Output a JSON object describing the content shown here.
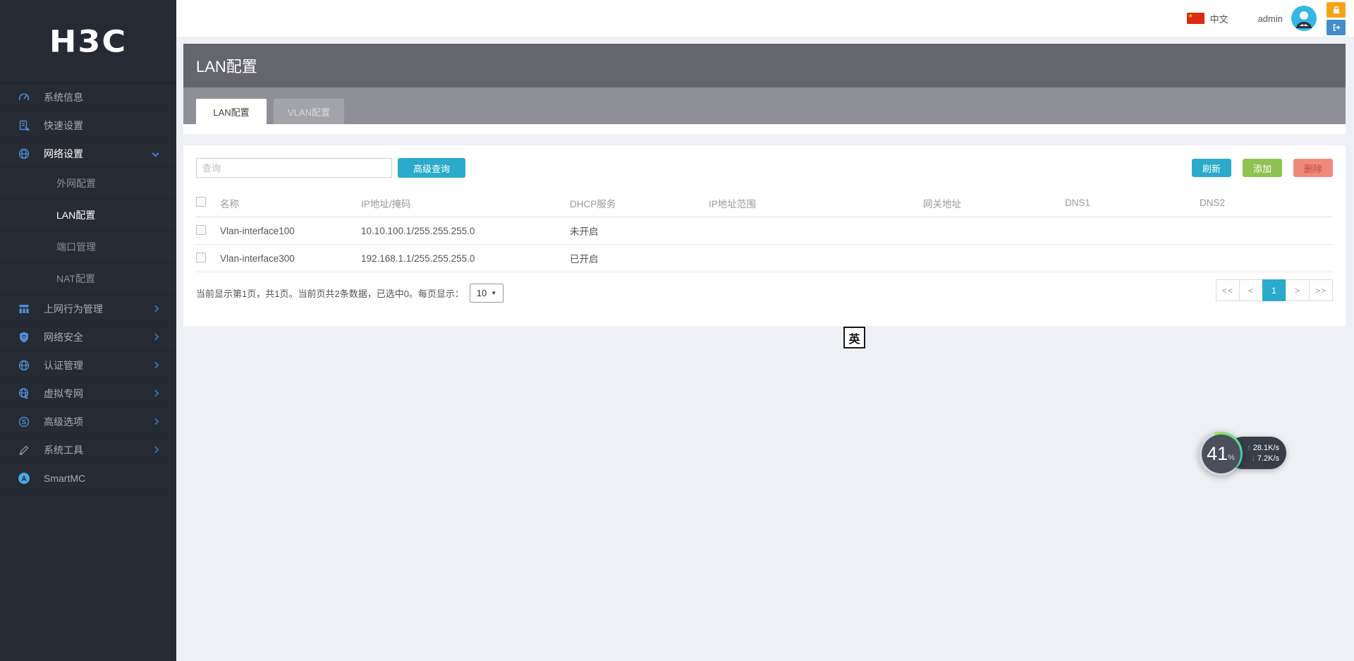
{
  "brand": {
    "logo_text": "H3C"
  },
  "colors": {
    "accent_blue": "#2baacb",
    "accent_green": "#8fc153",
    "accent_red": "#f0897b",
    "brand_orange": "#f5a31d",
    "sidebar_bg": "#262a33",
    "title_band": "#65666d"
  },
  "topbar": {
    "flag_icon": "china-flag-icon",
    "language_label": "中文",
    "username": "admin",
    "lock_icon": "lock-icon",
    "logout_icon": "logout-icon"
  },
  "sidebar": {
    "items": [
      {
        "label": "系统信息",
        "icon": "dashboard-icon"
      },
      {
        "label": "快速设置",
        "icon": "quick-setup-icon"
      },
      {
        "label": "网络设置",
        "icon": "globe-icon",
        "expanded": true,
        "children": [
          {
            "label": "外网配置"
          },
          {
            "label": "LAN配置",
            "active": true
          },
          {
            "label": "端口管理"
          },
          {
            "label": "NAT配置"
          }
        ]
      },
      {
        "label": "上网行为管理",
        "icon": "behavior-grid-icon"
      },
      {
        "label": "网络安全",
        "icon": "shield-icon"
      },
      {
        "label": "认证管理",
        "icon": "auth-globe-icon"
      },
      {
        "label": "虚拟专网",
        "icon": "vpn-globe-icon"
      },
      {
        "label": "高级选项",
        "icon": "advanced-globe-icon"
      },
      {
        "label": "系统工具",
        "icon": "tools-icon"
      },
      {
        "label": "SmartMC",
        "icon": "smartmc-icon"
      }
    ]
  },
  "page": {
    "title": "LAN配置",
    "tabs": [
      {
        "label": "LAN配置",
        "active": true
      },
      {
        "label": "VLAN配置",
        "active": false
      }
    ]
  },
  "toolbar": {
    "search_placeholder": "查询",
    "advanced_search_label": "高级查询",
    "refresh_label": "刷新",
    "add_label": "添加",
    "delete_label": "删除"
  },
  "table": {
    "columns": [
      "名称",
      "IP地址/掩码",
      "DHCP服务",
      "IP地址范围",
      "网关地址",
      "DNS1",
      "DNS2"
    ],
    "rows": [
      {
        "name": "Vlan-interface100",
        "ip_mask": "10.10.100.1/255.255.255.0",
        "dhcp": "未开启",
        "ip_range": "",
        "gateway": "",
        "dns1": "",
        "dns2": ""
      },
      {
        "name": "Vlan-interface300",
        "ip_mask": "192.168.1.1/255.255.255.0",
        "dhcp": "已开启",
        "ip_range": "",
        "gateway": "",
        "dns1": "",
        "dns2": ""
      }
    ]
  },
  "pagination": {
    "summary": "当前显示第1页，共1页。当前页共2条数据，已选中0。每页显示：",
    "page_size": "10",
    "caret": "▼",
    "first": "<<",
    "prev": "<",
    "page": "1",
    "next": ">",
    "last": ">>"
  },
  "floating": {
    "lang_badge": "英"
  },
  "monitor": {
    "percent": "41",
    "percent_sign": "%",
    "upload_arrow": "↑",
    "upload_speed": "28.1K/s",
    "download_arrow": "↓",
    "download_speed": "7.2K/s"
  }
}
